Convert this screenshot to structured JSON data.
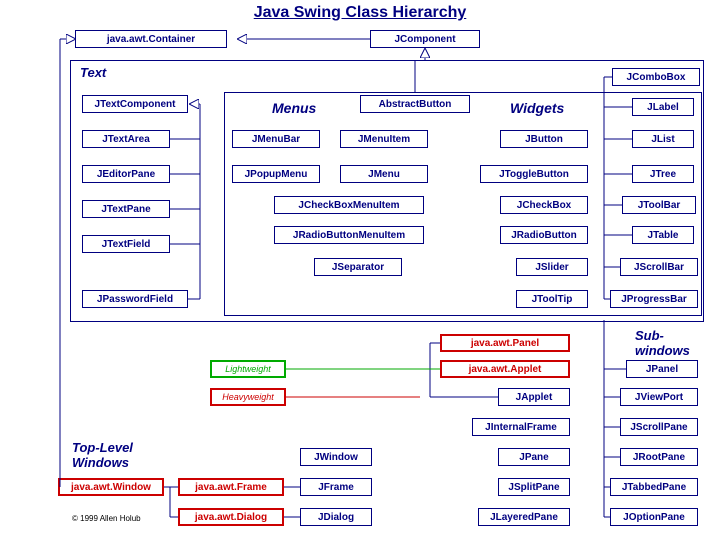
{
  "title": "Java Swing Class Hierarchy",
  "root": {
    "container": "java.awt.Container",
    "jcomponent": "JComponent"
  },
  "sections": {
    "text": "Text",
    "menus": "Menus",
    "widgets": "Widgets",
    "subwindows": "Sub-\nwindows",
    "toplevel": "Top-Level Windows"
  },
  "text_group": {
    "jtextcomponent": "JTextComponent",
    "jtextarea": "JTextArea",
    "jeditorpane": "JEditorPane",
    "jtextpane": "JTextPane",
    "jtextfield": "JTextField",
    "jpasswordfield": "JPasswordField"
  },
  "menus_group": {
    "abstractbutton": "AbstractButton",
    "jmenubar": "JMenuBar",
    "jpopupmenu": "JPopupMenu",
    "jmenuitem": "JMenuItem",
    "jmenu": "JMenu",
    "jcheckboxmenuitem": "JCheckBoxMenuItem",
    "jradiobuttonmenuitem": "JRadioButtonMenuItem",
    "jseparator": "JSeparator"
  },
  "widgets_group": {
    "jcombobox": "JComboBox",
    "jlabel": "JLabel",
    "jbutton": "JButton",
    "jlist": "JList",
    "jtogglebutton": "JToggleButton",
    "jtree": "JTree",
    "jcheckbox": "JCheckBox",
    "jtoolbar": "JToolBar",
    "jradiobutton": "JRadioButton",
    "jtable": "JTable",
    "jslider": "JSlider",
    "jscrollbar": "JScrollBar",
    "jtooltip": "JToolTip",
    "jprogressbar": "JProgressBar"
  },
  "subwindows_group": {
    "javaawtpanel": "java.awt.Panel",
    "javaawtapplet": "java.awt.Applet",
    "japplet": "JApplet",
    "jpanel": "JPanel",
    "jviewport": "JViewPort",
    "jinternalframe": "JInternalFrame",
    "jscrollpane": "JScrollPane",
    "jpane": "JPane",
    "jrootpane": "JRootPane",
    "jsplitpane": "JSplitPane",
    "jtabbedpane": "JTabbedPane",
    "jlayeredpane": "JLayeredPane",
    "joptionpane": "JOptionPane"
  },
  "toplevel_group": {
    "javaawtwindow": "java.awt.Window",
    "javaawtframe": "java.awt.Frame",
    "javaawtdialog": "java.awt.Dialog",
    "jwindow": "JWindow",
    "jframe": "JFrame",
    "jdialog": "JDialog"
  },
  "legend": {
    "lightweight": "Lightweight",
    "heavyweight": "Heavyweight"
  },
  "copyright": "© 1999 Allen Holub",
  "chart_data": {
    "type": "hierarchy",
    "title": "Java Swing Class Hierarchy",
    "root": "java.awt.Container",
    "children": [
      {
        "name": "JComponent",
        "groups": [
          {
            "section": "Text",
            "root": "JTextComponent",
            "children": [
              "JTextArea",
              "JEditorPane",
              "JTextPane",
              "JTextField",
              "JPasswordField"
            ]
          },
          {
            "section": "Menus",
            "root": "AbstractButton",
            "children": [
              "JMenuBar",
              "JPopupMenu",
              "JMenuItem",
              "JMenu",
              "JCheckBoxMenuItem",
              "JRadioButtonMenuItem",
              "JSeparator"
            ]
          },
          {
            "section": "Widgets",
            "children": [
              "JComboBox",
              "JLabel",
              "JButton",
              "JList",
              "JToggleButton",
              "JTree",
              "JCheckBox",
              "JToolBar",
              "JRadioButton",
              "JTable",
              "JSlider",
              "JScrollBar",
              "JToolTip",
              "JProgressBar"
            ]
          },
          {
            "section": "Sub-windows",
            "children": [
              "java.awt.Panel",
              "java.awt.Applet",
              "JApplet",
              "JPanel",
              "JViewPort",
              "JInternalFrame",
              "JScrollPane",
              "JPane",
              "JRootPane",
              "JSplitPane",
              "JTabbedPane",
              "JLayeredPane",
              "JOptionPane"
            ]
          }
        ]
      },
      {
        "section": "Top-Level Windows",
        "root": "java.awt.Window",
        "children": [
          "java.awt.Frame",
          "java.awt.Dialog",
          "JWindow",
          "JFrame",
          "JDialog"
        ]
      }
    ]
  }
}
